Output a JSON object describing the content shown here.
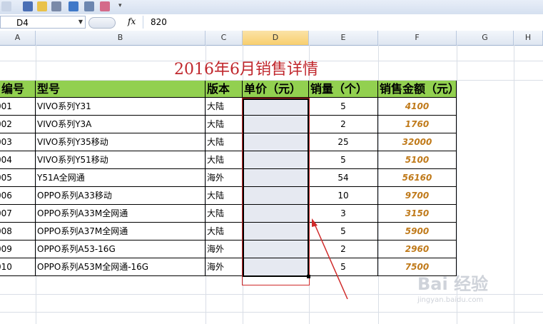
{
  "formula_bar": {
    "cell_ref": "D4",
    "fx_label": "fx",
    "value": "820"
  },
  "columns": [
    "A",
    "B",
    "C",
    "D",
    "E",
    "F",
    "G",
    "H"
  ],
  "sheet": {
    "title": "2016年6月销售详情",
    "headers": [
      "编号",
      "型号",
      "版本",
      "单价（元）",
      "销量（个）",
      "销售金额（元）"
    ],
    "rows": [
      {
        "id": "001",
        "model": "VIVO系列Y31",
        "version": "大陆",
        "price": "",
        "qty": "5",
        "amount": "4100"
      },
      {
        "id": "002",
        "model": "VIVO系列Y3A",
        "version": "大陆",
        "price": "",
        "qty": "2",
        "amount": "1760"
      },
      {
        "id": "003",
        "model": "VIVO系列Y35移动",
        "version": "大陆",
        "price": "",
        "qty": "25",
        "amount": "32000"
      },
      {
        "id": "004",
        "model": "VIVO系列Y51移动",
        "version": "大陆",
        "price": "",
        "qty": "5",
        "amount": "5100"
      },
      {
        "id": "005",
        "model": "Y51A全网通",
        "version": "海外",
        "price": "",
        "qty": "54",
        "amount": "56160"
      },
      {
        "id": "006",
        "model": "OPPO系列A33移动",
        "version": "大陆",
        "price": "",
        "qty": "10",
        "amount": "9700"
      },
      {
        "id": "007",
        "model": "OPPO系列A33M全网通",
        "version": "大陆",
        "price": "",
        "qty": "3",
        "amount": "3150"
      },
      {
        "id": "008",
        "model": "OPPO系列A37M全网通",
        "version": "大陆",
        "price": "",
        "qty": "5",
        "amount": "5900"
      },
      {
        "id": "009",
        "model": "OPPO系列A53-16G",
        "version": "海外",
        "price": "",
        "qty": "2",
        "amount": "2960"
      },
      {
        "id": "010",
        "model": "OPPO系列A53M全网通-16G",
        "version": "海外",
        "price": "",
        "qty": "5",
        "amount": "7500"
      }
    ]
  },
  "watermark": {
    "line1": "Bai 经验",
    "line2": "jingyan.baidu.com"
  },
  "colors": {
    "title": "#c0272d",
    "header_fill": "#92d050",
    "amount_text": "#c07a1a",
    "annotation": "#d02a2a"
  }
}
